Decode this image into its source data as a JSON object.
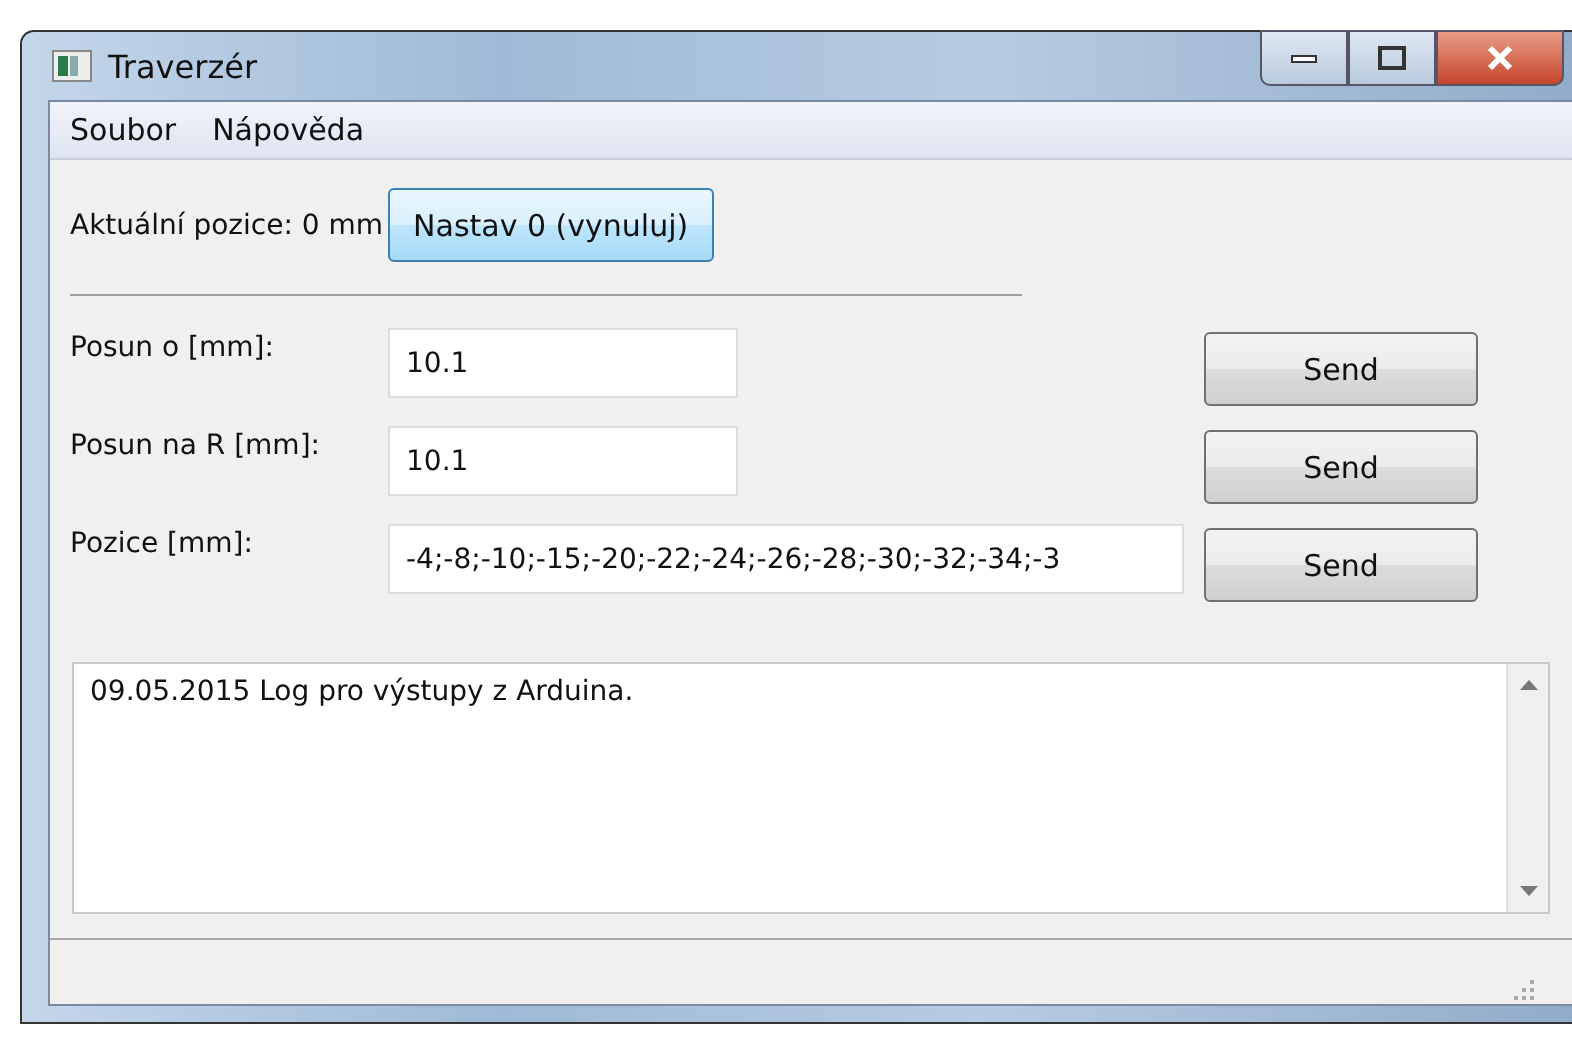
{
  "window": {
    "title": "Traverzér"
  },
  "menu": [
    "Soubor",
    "Nápověda"
  ],
  "position": {
    "label": "Aktuální pozice: 0 mm",
    "button": "Nastav 0 (vynuluj)"
  },
  "rows": [
    {
      "label": "Posun o [mm]:",
      "value": "10.1",
      "button": "Send"
    },
    {
      "label": "Posun na R [mm]:",
      "value": "10.1",
      "button": "Send"
    },
    {
      "label": "Pozice [mm]:",
      "value": "-4;-8;-10;-15;-20;-22;-24;-26;-28;-30;-32;-34;-3",
      "button": "Send"
    }
  ],
  "log": {
    "text": "09.05.2015 Log pro výstupy z Arduina."
  }
}
